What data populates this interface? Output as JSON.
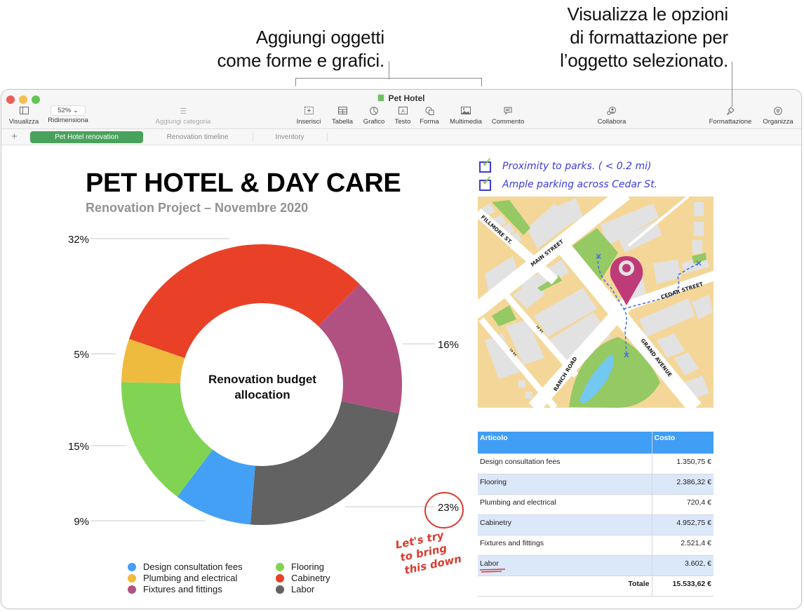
{
  "callouts": {
    "insert_objects": [
      "Aggiungi oggetti",
      "come forme e grafici."
    ],
    "format_options": [
      "Visualizza le opzioni",
      "di formattazione per",
      "l’oggetto selezionato."
    ]
  },
  "window": {
    "title": "Pet Hotel",
    "toolbar": {
      "view": {
        "label": "Visualizza",
        "icon": "sidebar-icon"
      },
      "zoom": {
        "label": "Ridimensiona",
        "value": "52%"
      },
      "add_category": {
        "label": "Aggiungi categoria",
        "icon": "list-icon"
      },
      "insert": {
        "label": "Inserisci",
        "icon": "insert-icon"
      },
      "table": {
        "label": "Tabella",
        "icon": "table-icon"
      },
      "chart": {
        "label": "Grafico",
        "icon": "chart-icon"
      },
      "text": {
        "label": "Testo",
        "icon": "text-box-icon"
      },
      "shape": {
        "label": "Forma",
        "icon": "shape-icon"
      },
      "media": {
        "label": "Multimedia",
        "icon": "image-icon"
      },
      "comment": {
        "label": "Commento",
        "icon": "comment-icon"
      },
      "collaborate": {
        "label": "Collabora",
        "icon": "collaborate-icon"
      },
      "format": {
        "label": "Formattazione",
        "icon": "paintbrush-icon"
      },
      "organize": {
        "label": "Organizza",
        "icon": "organize-icon"
      }
    },
    "tabs": [
      {
        "label": "Pet Hotel renovation",
        "active": true
      },
      {
        "label": "Renovation timeline",
        "active": false
      },
      {
        "label": "Inventory",
        "active": false
      }
    ],
    "add_sheet_label": "+"
  },
  "sheet": {
    "title": "PET HOTEL & DAY CARE",
    "subtitle": "Renovation Project – Novembre 2020",
    "checklist": [
      "Proximity to parks. ( < 0.2 mi)",
      "Ample parking across  Cedar St."
    ],
    "map_labels": {
      "fillmore": "FILLMORE ST.",
      "main": "MAIN STREET",
      "cedar": "CEDAR STREET",
      "grand": "GRAND AVENUE",
      "ranch": "RANCH ROAD",
      "street_18": "18 ST.",
      "street_19": "19 ST."
    },
    "annotation": [
      "Let's try",
      "to bring",
      "this down"
    ],
    "table": {
      "headers": [
        "Articolo",
        "Costo"
      ],
      "rows": [
        {
          "item": "Design consultation fees",
          "cost": "1.350,75 €"
        },
        {
          "item": "Flooring",
          "cost": "2.386,32 €"
        },
        {
          "item": "Plumbing and electrical",
          "cost": "720,4 €"
        },
        {
          "item": "Cabinetry",
          "cost": "4.952,75 €"
        },
        {
          "item": "Fixtures and fittings",
          "cost": "2.521,4 €"
        },
        {
          "item": "Labor",
          "cost": "3.602, €"
        }
      ],
      "total_label": "Totale",
      "total_value": "15.533,62 €"
    }
  },
  "chart_data": {
    "type": "pie",
    "variant": "donut",
    "title": "Renovation budget allocation",
    "slices": [
      {
        "label": "Cabinetry",
        "value": 32,
        "display": "32%",
        "color": "#e94128"
      },
      {
        "label": "Fixtures and fittings",
        "value": 16,
        "display": "16%",
        "color": "#b15182"
      },
      {
        "label": "Labor",
        "value": 23,
        "display": "23%",
        "color": "#626262"
      },
      {
        "label": "Design consultation fees",
        "value": 9,
        "display": "9%",
        "color": "#43a0f5"
      },
      {
        "label": "Flooring",
        "value": 15,
        "display": "15%",
        "color": "#81d353"
      },
      {
        "label": "Plumbing and electrical",
        "value": 5,
        "display": "5%",
        "color": "#efbb3f"
      }
    ],
    "legend": [
      {
        "label": "Design consultation fees",
        "color": "#43a0f5"
      },
      {
        "label": "Plumbing and electrical",
        "color": "#efbb3f"
      },
      {
        "label": "Fixtures and fittings",
        "color": "#b15182"
      },
      {
        "label": "Flooring",
        "color": "#81d353"
      },
      {
        "label": "Cabinetry",
        "color": "#e94128"
      },
      {
        "label": "Labor",
        "color": "#626262"
      }
    ],
    "legend_position": "bottom",
    "highlighted_label": "23%"
  }
}
